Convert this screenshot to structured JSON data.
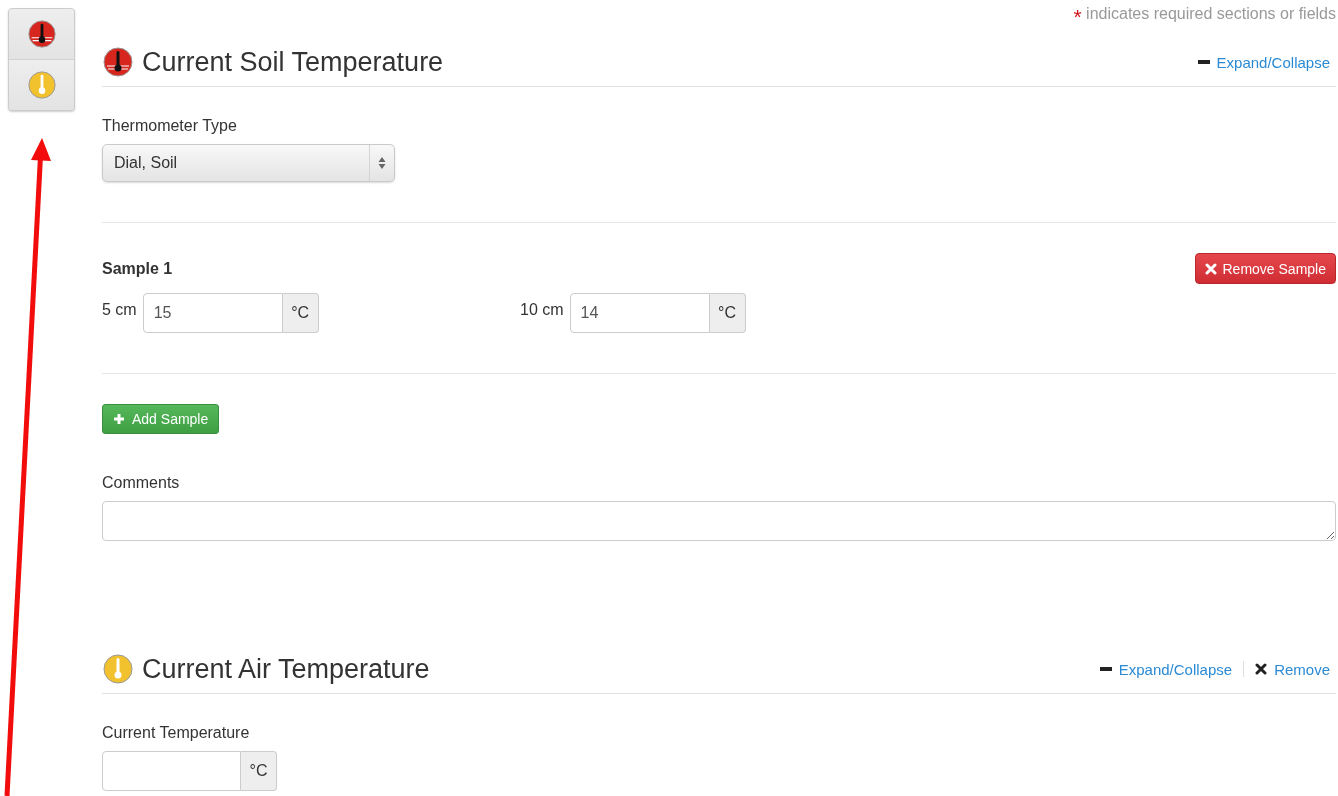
{
  "required_note": {
    "mark": "*",
    "text": "indicates required sections or fields"
  },
  "nav": [
    {
      "kind": "soil"
    },
    {
      "kind": "air"
    }
  ],
  "sections": [
    {
      "kind": "soil",
      "title": "Current Soil Temperature",
      "actions": [
        {
          "kind": "collapse",
          "label": "Expand/Collapse"
        }
      ],
      "fields": [
        {
          "kind": "select",
          "label": "Thermometer Type",
          "value": "Dial, Soil"
        },
        {
          "kind": "sample",
          "title": "Sample 1",
          "remove_label": "Remove Sample",
          "readings": [
            {
              "label": "5 cm",
              "value": "15",
              "unit": "°C"
            },
            {
              "label": "10 cm",
              "value": "14",
              "unit": "°C"
            }
          ]
        },
        {
          "kind": "add_button",
          "label": "Add Sample"
        },
        {
          "kind": "textarea",
          "label": "Comments"
        }
      ]
    },
    {
      "kind": "air",
      "title": "Current Air Temperature",
      "actions": [
        {
          "kind": "collapse",
          "label": "Expand/Collapse"
        },
        {
          "kind": "remove",
          "label": "Remove"
        }
      ],
      "fields": [
        {
          "kind": "unit_input",
          "label": "Current Temperature",
          "unit": "°C"
        }
      ]
    }
  ]
}
